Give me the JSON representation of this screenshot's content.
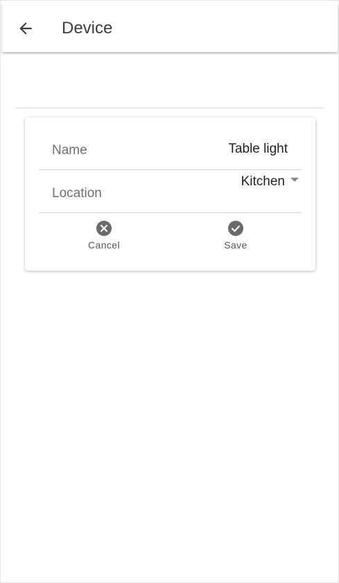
{
  "header": {
    "title": "Device",
    "back_icon": "arrow-left-icon"
  },
  "form": {
    "name_label": "Name",
    "name_value": "Table light",
    "location_label": "Location",
    "location_value": "Kitchen"
  },
  "actions": {
    "cancel_label": "Cancel",
    "cancel_icon": "cancel-circle-icon",
    "save_label": "Save",
    "save_icon": "check-circle-icon"
  },
  "colors": {
    "icon": "#6a6a6a",
    "title": "#3c3c3c"
  }
}
